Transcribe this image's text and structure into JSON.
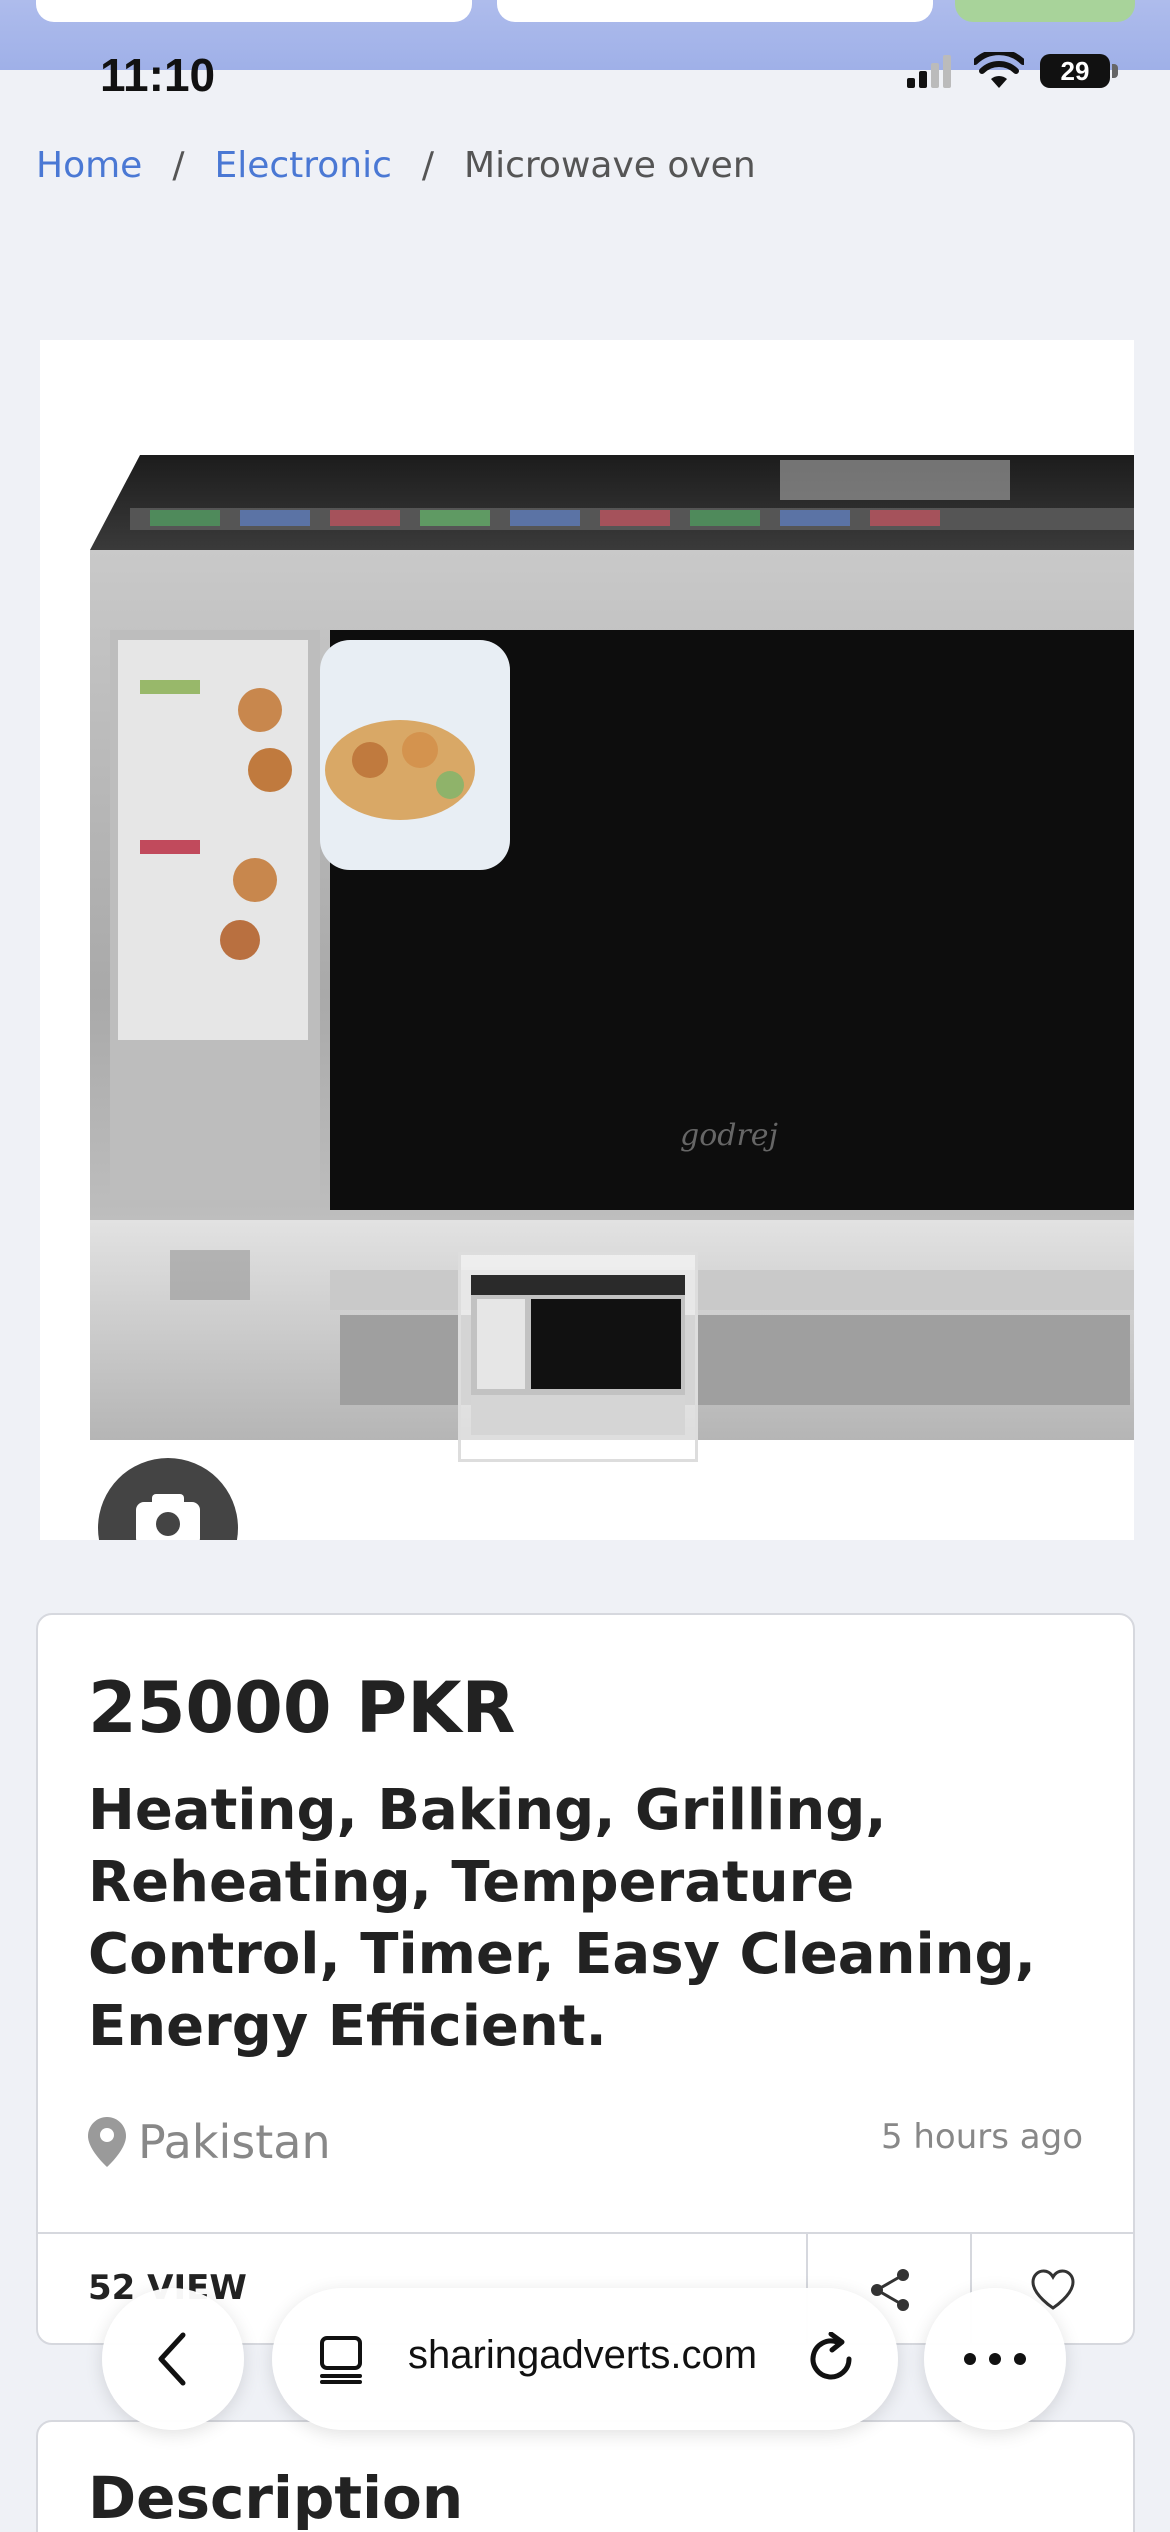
{
  "status_bar": {
    "time": "11:10",
    "battery": "29"
  },
  "breadcrumb": {
    "home": "Home",
    "separator": "/",
    "category": "Electronic",
    "current": "Microwave oven"
  },
  "listing": {
    "price": "25000 PKR",
    "title": "Heating, Baking, Grilling, Reheating, Temperature Control, Timer, Easy Cleaning, Energy Efficient.",
    "location": "Pakistan",
    "posted": "5 hours ago",
    "views": "52 VIEW"
  },
  "description": {
    "heading": "Description"
  },
  "browser": {
    "url": "sharingadverts.com"
  },
  "colors": {
    "link": "#4a78d4",
    "page_background": "#eff1f6"
  },
  "icons": {
    "location": "map-pin-icon",
    "share": "share-icon",
    "favorite": "heart-icon",
    "camera": "camera-icon",
    "back": "chevron-left-icon",
    "tabs": "tabs-icon",
    "reload": "reload-icon",
    "more": "more-icon"
  }
}
